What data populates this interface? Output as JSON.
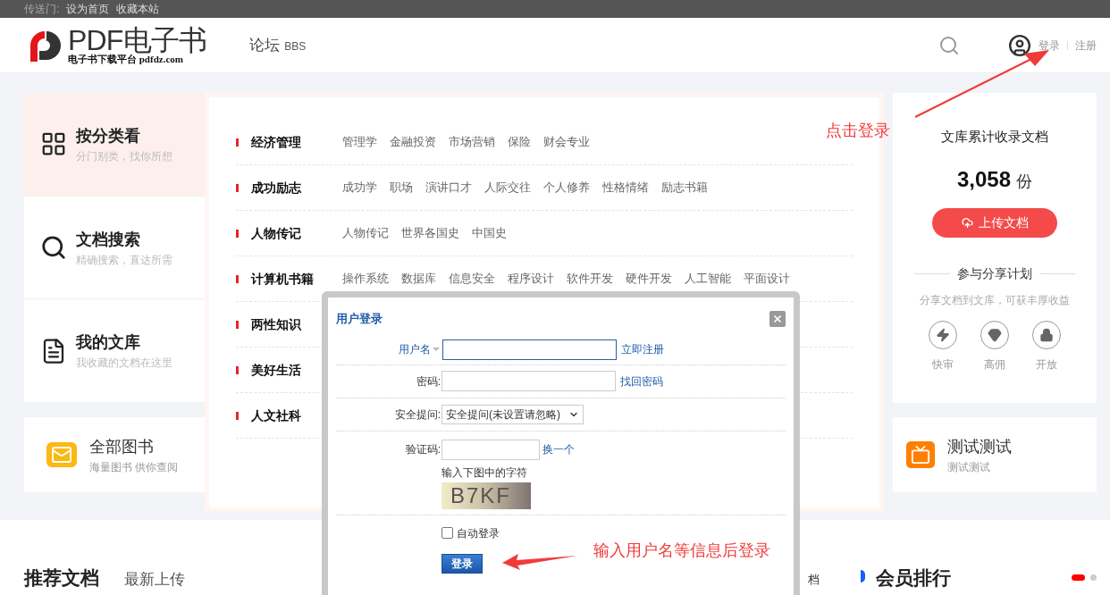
{
  "top_bar": {
    "label": "传送门:",
    "links": [
      "设为首页",
      "收藏本站"
    ]
  },
  "header": {
    "logo_title": "PDF电子书",
    "logo_subtitle": "电子书下载平台 pdfdz.com",
    "forum": "论坛",
    "forum_en": "BBS",
    "login": "登录",
    "register": "注册"
  },
  "left_nav": [
    {
      "kind": "grid",
      "title": "按分类看",
      "subtitle": "分门别类，找你所想",
      "selected": true
    },
    {
      "kind": "search",
      "title": "文档搜索",
      "subtitle": "精确搜索，直达所需",
      "selected": false
    },
    {
      "kind": "file",
      "title": "我的文库",
      "subtitle": "我收藏的文档在这里",
      "selected": false
    }
  ],
  "left_card": {
    "title": "全部图书",
    "subtitle": "海量图书 供你查阅"
  },
  "categories": [
    {
      "name": "经济管理",
      "tags": [
        "管理学",
        "金融投资",
        "市场营销",
        "保险",
        "财会专业"
      ]
    },
    {
      "name": "成功励志",
      "tags": [
        "成功学",
        "职场",
        "演讲口才",
        "人际交往",
        "个人修养",
        "性格情绪",
        "励志书籍"
      ]
    },
    {
      "name": "人物传记",
      "tags": [
        "人物传记",
        "世界各国史",
        "中国史"
      ]
    },
    {
      "name": "计算机书籍",
      "tags": [
        "操作系统",
        "数据库",
        "信息安全",
        "程序设计",
        "软件开发",
        "硬件开发",
        "人工智能",
        "平面设计"
      ]
    },
    {
      "name": "两性知识"
    },
    {
      "name": "美好生活"
    },
    {
      "name": "人文社科"
    }
  ],
  "stats_card": {
    "title": "文库累计收录文档",
    "count": "3,058",
    "unit": "份",
    "upload": "上传文档",
    "plan_title": "参与分享计划",
    "plan_subtitle": "分享文档到文库，可获丰厚收益",
    "features": [
      {
        "kind": "bolt",
        "label": "快审"
      },
      {
        "kind": "gem",
        "label": "高佣"
      },
      {
        "kind": "lock",
        "label": "开放"
      }
    ]
  },
  "right_card": {
    "title": "测试测试",
    "subtitle": "测试测试"
  },
  "bottom": {
    "tabs": [
      {
        "label": "推荐文档",
        "selected": true
      },
      {
        "label": "最新上传",
        "selected": false
      }
    ],
    "partial": "档",
    "ranking": "会员排行",
    "pager": [
      {
        "selected": true
      },
      {
        "selected": false
      }
    ]
  },
  "login_dialog": {
    "title": "用户登录",
    "username_label": "用户名",
    "register_link": "立即注册",
    "password_label": "密码:",
    "forgot_link": "找回密码",
    "question_label": "安全提问:",
    "question_value": "安全提问(未设置请忽略)",
    "captcha_label": "验证码:",
    "captcha_refresh": "换一个",
    "captcha_hint": "输入下图中的字符",
    "captcha_text": "B7KF",
    "auto_login": "自动登录",
    "auto_login_checked": false,
    "submit": "登录"
  },
  "annotations": [
    {
      "kind": "top",
      "text": "点击登录"
    },
    {
      "kind": "bottom",
      "text": "输入用户名等信息后登录"
    }
  ]
}
